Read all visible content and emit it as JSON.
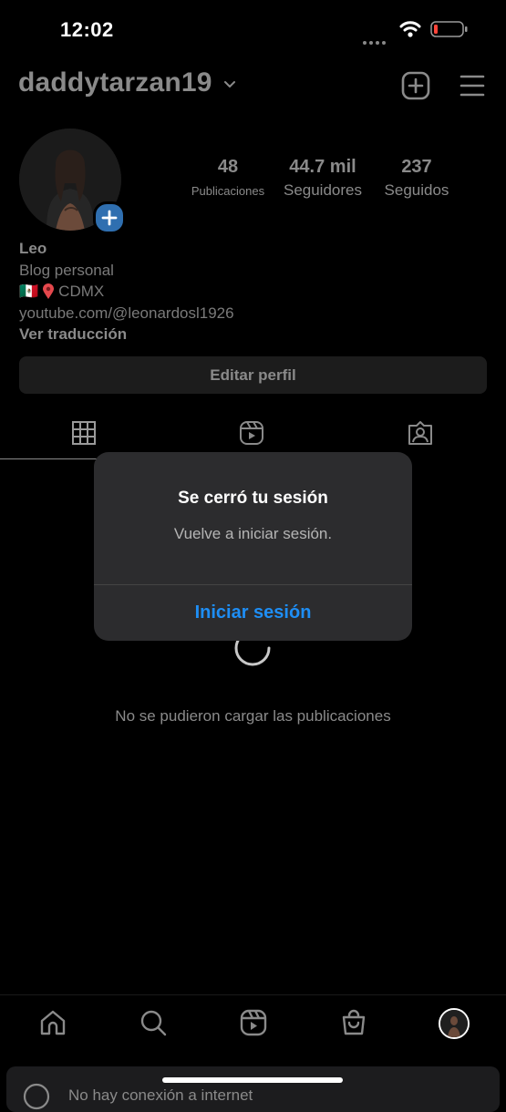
{
  "status_bar": {
    "time": "12:02"
  },
  "header": {
    "username": "daddytarzan19",
    "icons": [
      "chevron-down-icon",
      "plus-square-icon",
      "hamburger-menu-icon"
    ]
  },
  "profile": {
    "stats": [
      {
        "value": "48",
        "label": "Publicaciones"
      },
      {
        "value": "44.7 mil",
        "label": "Seguidores"
      },
      {
        "value": "237",
        "label": "Seguidos"
      }
    ],
    "bio": {
      "name": "Leo",
      "category": "Blog personal",
      "location_flag": "🇲🇽",
      "location": "CDMX",
      "link": "youtube.com/@leonardosl1926",
      "translate": "Ver traducción"
    },
    "edit_button": "Editar perfil"
  },
  "tabs": [
    "grid-icon",
    "reels-icon",
    "tagged-icon"
  ],
  "content": {
    "error": "No se pudieron cargar las publicaciones"
  },
  "dialog": {
    "title": "Se cerró tu sesión",
    "message": "Vuelve a iniciar sesión.",
    "button": "Iniciar sesión"
  },
  "bottom_nav": [
    "home-icon",
    "search-icon",
    "reels-icon",
    "shop-icon",
    "profile-avatar"
  ],
  "banner": {
    "text": "No hay conexión a internet"
  },
  "colors": {
    "accent": "#1e8ef5",
    "dialog_bg": "#2c2c2e",
    "muted_text": "#8a8a8a"
  }
}
